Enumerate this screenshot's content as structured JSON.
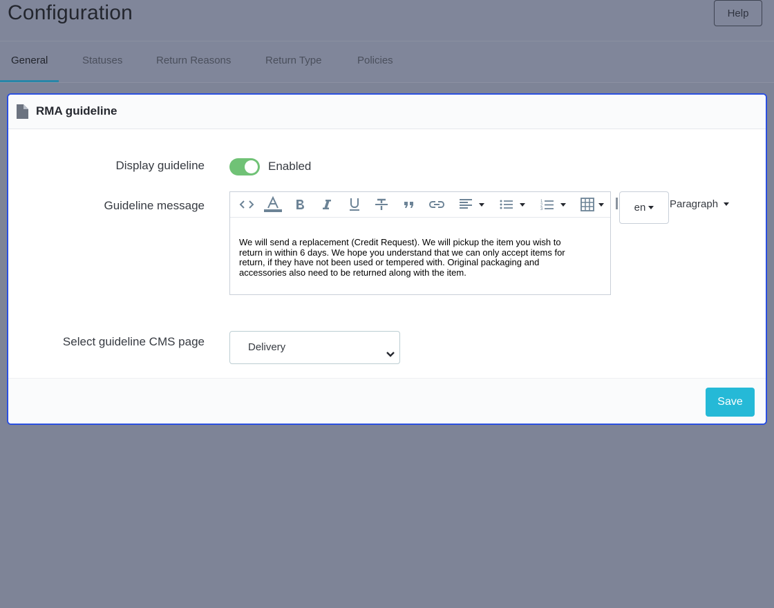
{
  "header": {
    "title": "Configuration",
    "help_label": "Help"
  },
  "tabs": [
    {
      "label": "General",
      "active": true
    },
    {
      "label": "Statuses",
      "active": false
    },
    {
      "label": "Return Reasons",
      "active": false
    },
    {
      "label": "Return Type",
      "active": false
    },
    {
      "label": "Policies",
      "active": false
    }
  ],
  "panel": {
    "title": "RMA guideline",
    "title_icon": "document-icon",
    "display_guideline": {
      "label": "Display guideline",
      "value": "Enabled",
      "enabled": true
    },
    "guideline_message": {
      "label": "Guideline message",
      "toolbar_icons": [
        "code-view-icon",
        "text-color-icon",
        "bold-icon",
        "italic-icon",
        "underline-icon",
        "strikethrough-icon",
        "blockquote-icon",
        "link-icon",
        "align-icon",
        "bullet-list-icon",
        "numbered-list-icon",
        "table-icon"
      ],
      "text": "We will send a replacement (Credit Request). We will pickup the item you wish to return in within 6 days. We hope you understand that we can only accept items for return, if they have not been used or tempered with. Original packaging and accessories also need to be returned along with the item.",
      "language": "en",
      "block_format": "Paragraph"
    },
    "cms_page": {
      "label": "Select guideline CMS page",
      "value": "Delivery"
    },
    "save_label": "Save"
  },
  "colors": {
    "accent": "#25b9d7",
    "toggle_on": "#70c276",
    "focus_border": "#2a4fe0",
    "active_tab": "#2786a8"
  }
}
